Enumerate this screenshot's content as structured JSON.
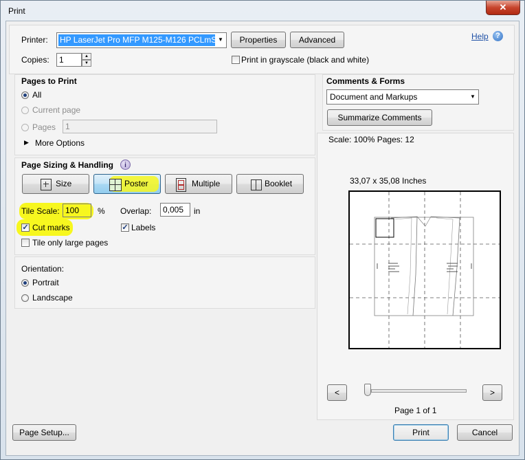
{
  "window": {
    "title": "Print",
    "close": "✕"
  },
  "printer": {
    "label": "Printer:",
    "value": "HP LaserJet Pro MFP M125-M126 PCLmS",
    "properties": "Properties",
    "advanced": "Advanced"
  },
  "help": {
    "label": "Help",
    "icon": "?"
  },
  "copies": {
    "label": "Copies:",
    "value": "1"
  },
  "grayscale": {
    "label": "Print in grayscale (black and white)",
    "checked": false
  },
  "pages": {
    "heading": "Pages to Print",
    "all": "All",
    "current": "Current page",
    "pages_label": "Pages",
    "pages_value": "1",
    "more": "More Options"
  },
  "sizing": {
    "heading": "Page Sizing & Handling",
    "info_icon": "i",
    "tabs": [
      "Size",
      "Poster",
      "Multiple",
      "Booklet"
    ],
    "selected_tab": "Poster",
    "tile_scale_label": "Tile Scale:",
    "tile_scale_value": "100",
    "percent": "%",
    "overlap_label": "Overlap:",
    "overlap_value": "0,005",
    "overlap_unit": "in",
    "cut_marks": "Cut marks",
    "labels": "Labels",
    "tile_large": "Tile only large pages"
  },
  "orientation": {
    "heading": "Orientation:",
    "portrait": "Portrait",
    "landscape": "Landscape"
  },
  "comments": {
    "heading": "Comments & Forms",
    "value": "Document and Markups",
    "summarize": "Summarize Comments"
  },
  "preview": {
    "scale_text": "Scale: 100% Pages: 12",
    "dimensions": "33,07 x 35,08 Inches",
    "prev": "<",
    "next": ">",
    "page_text": "Page 1 of 1"
  },
  "footer": {
    "page_setup": "Page Setup...",
    "print": "Print",
    "cancel": "Cancel"
  },
  "colors": {
    "highlight": "#f7f71f",
    "selection": "#3399ff"
  }
}
